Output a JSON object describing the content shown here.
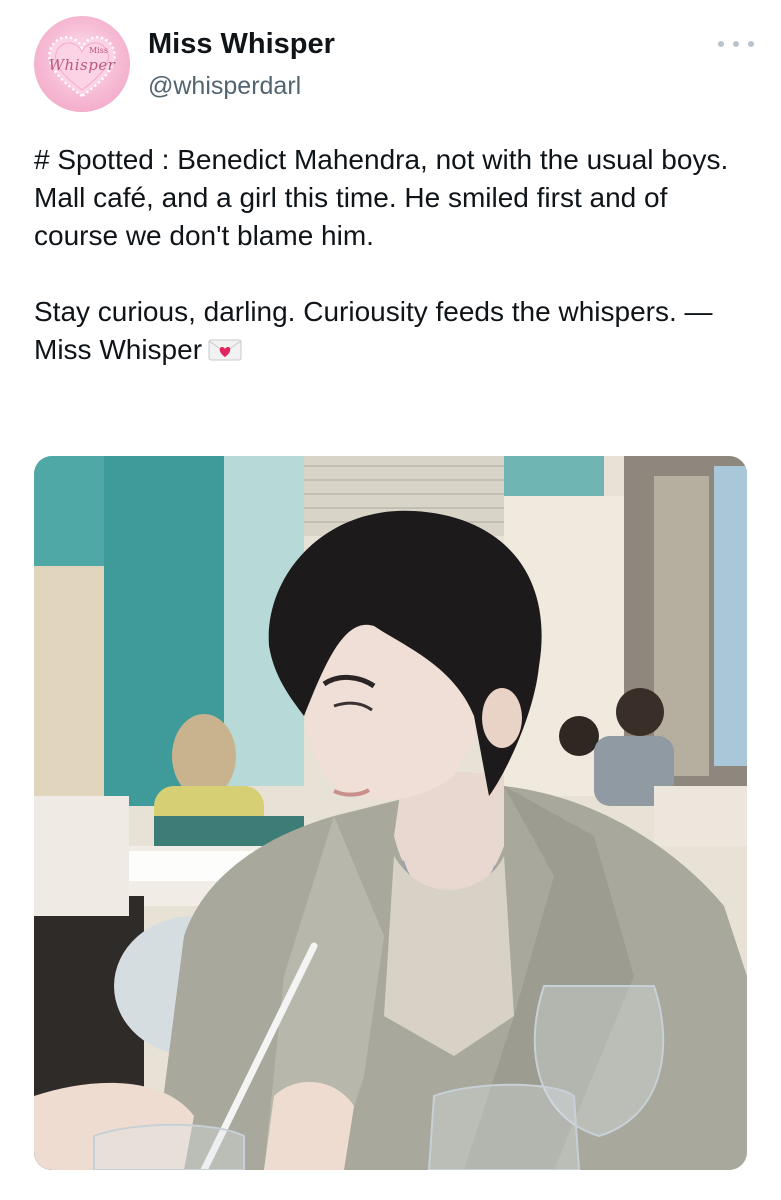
{
  "author": {
    "display_name": "Miss Whisper",
    "handle": "@whisperdarl",
    "avatar_logo_text": "Whisper",
    "avatar_logo_small": "Miss"
  },
  "menu": {
    "icon": "more-horizontal-icon"
  },
  "post": {
    "paragraph_1": "# Spotted : Benedict Mahendra, not with the usual boys. Mall café, and a girl this time. He smiled first and of course we don't blame him.",
    "paragraph_2": "Stay curious, darling. Curiousity feeds the whispers. — Miss Whisper",
    "emoji_icon": "love-letter-icon"
  },
  "media": {
    "kind": "photo"
  },
  "colors": {
    "name": "#0f1419",
    "handle": "#536471",
    "avatar_pink": "#f6b9d3",
    "wall_teal": "#4fa8a6"
  }
}
